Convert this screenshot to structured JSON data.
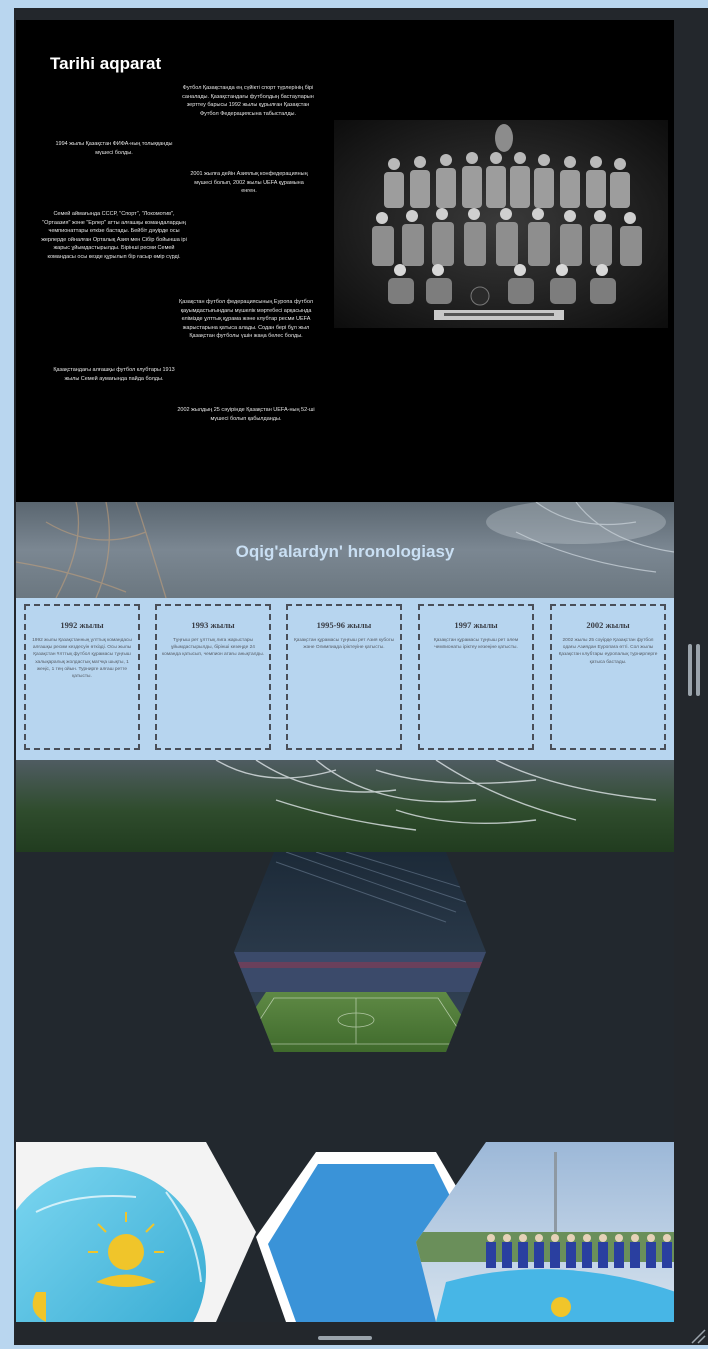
{
  "history": {
    "title": "Tarihi aqparat",
    "left_col": [
      "1994 жылы Қазақстан ФИФА-ның толыққанды мүшесі болды.",
      "Семей аймағында СССР, \"Спорт\", \"Локомотив\", \"Ортаазия\" және \"Ерлер\" атты алғашқы командалардың чемпионаттары өткізе бастады. Бейбіт дәуірде осы жерлерде ойналған Орталық Азия мен Сібір бойынша ірі жарыс ұйымдастырылды. Бірінші ресми Семей командасы осы кезде құрылып бір ғасыр өмір сүрді.",
      "Қазақстандағы алғашқы футбол клубтары 1913 жылы Семей аумағында пайда болды."
    ],
    "mid_col": [
      "Футбол Қазақстанда ең сүйікті спорт түрлерінің бірі саналады. Қазақстандағы футболдың бастауларын зерттеу барысы 1992 жылы құрылған Қазақстан Футбол Федерациясына табысталды.",
      "2001 жылға дейін Азиялық конфедерацияның мүшесі болып, 2002 жылы UEFA құрамына енген.",
      "Қазақстан футбол федерациясының Еуропа футбол қауымдастығындағы мүшелік мәртебесі арқасында елімізде ұлттық құрама және клубтар ресми UEFA жарыстарына қатыса алады. Содан бері бұл жыл Қазақстан футболы үшін жаңа белес болды.",
      "2002 жылдың 25 сәуірінде Қазақстан UEFA-ның 52-ші мүшесі болып қабылданды."
    ]
  },
  "timeline": {
    "title": "Oqig'alardyn' hronologiasy",
    "cards": [
      {
        "year": "1992 жылы",
        "desc": "1992 жылы Қазақстанның ұлттық командасы алғашқы ресми кездесуін өткізді. Осы жылы Қазақстан Ұлттық футбол құрамасы тұңғыш халықаралық жолдастық матчқа шықты, 1 жеңіс, 1 тең ойын. Турнирге алғаш ретте қатысты."
      },
      {
        "year": "1993 жылы",
        "desc": "Тұңғыш рет ұлттық лига жарыстары ұйымдастырылды, бірінші кезеңде 24 команда қатысып, чемпион атағы анықталды."
      },
      {
        "year": "1995-96 жылы",
        "desc": "Қазақстан құрамасы тұңғыш рет Азия кубогы және Олимпиада іріктеуіне қатысты."
      },
      {
        "year": "1997 жылы",
        "desc": "Қазақстан құрамасы тұңғыш рет әлем чемпионаты іріктеу кезеңіне қатысты."
      },
      {
        "year": "2002 жылы",
        "desc": "2002 жылы 25 сәуірде Қазақстан футбол одағы Азиядан Еуропаға өтті. Сол жылы Қазақстан клубтары еуропалық турнирлерге қатыса бастады."
      }
    ]
  },
  "gallery": {
    "images": [
      "football-ball-kazakh-flag",
      "stadium-interior",
      "team-lineup-with-flag",
      "blue-hexagon-tile"
    ]
  },
  "colors": {
    "frame": "#b9d6ef",
    "viewer_bg": "#23272c",
    "timeline_band": "#b7d5ef",
    "timeline_title": "#c9dff3",
    "history_bg": "#000000"
  }
}
